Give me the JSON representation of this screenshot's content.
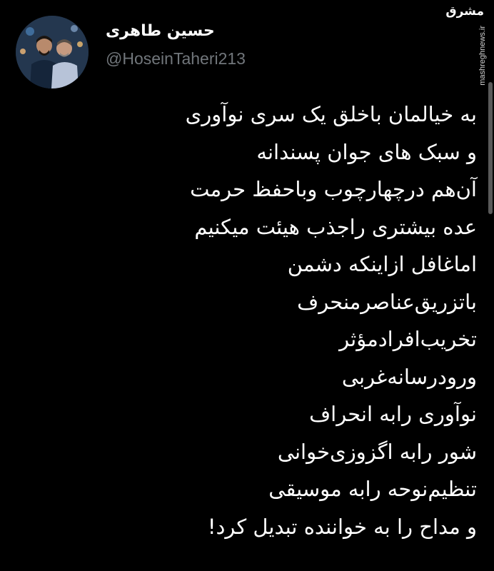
{
  "author": {
    "display_name": "حسین طاهری",
    "handle": "@HoseinTaheri213",
    "avatar_icon": "profile-photo-two-men"
  },
  "watermark": {
    "logo_text": "مشرق",
    "site": "mashreghnews.ir"
  },
  "tweet": {
    "lines": [
      "به خیالمان باخلق یک سری نوآوری",
      "و سبک های جوان پسندانه",
      "آن‌هم درچهارچوب وباحفظ حرمت",
      "عده بیشتری راجذب هیئت میکنیم",
      "اماغافل ازاینکه دشمن",
      "باتزریق‌عناصرمنحرف",
      "تخریب‌افرادمؤثر",
      "ورودرسانه‌غربی",
      "نوآوری رابه انحراف",
      "شور رابه اگزوزی‌خوانی",
      "تنظیم‌نوحه رابه موسیقی",
      "و مداح را به خواننده تبدیل کرد!"
    ]
  },
  "colors": {
    "background": "#000000",
    "text": "#ffffff",
    "handle": "#71767b"
  }
}
